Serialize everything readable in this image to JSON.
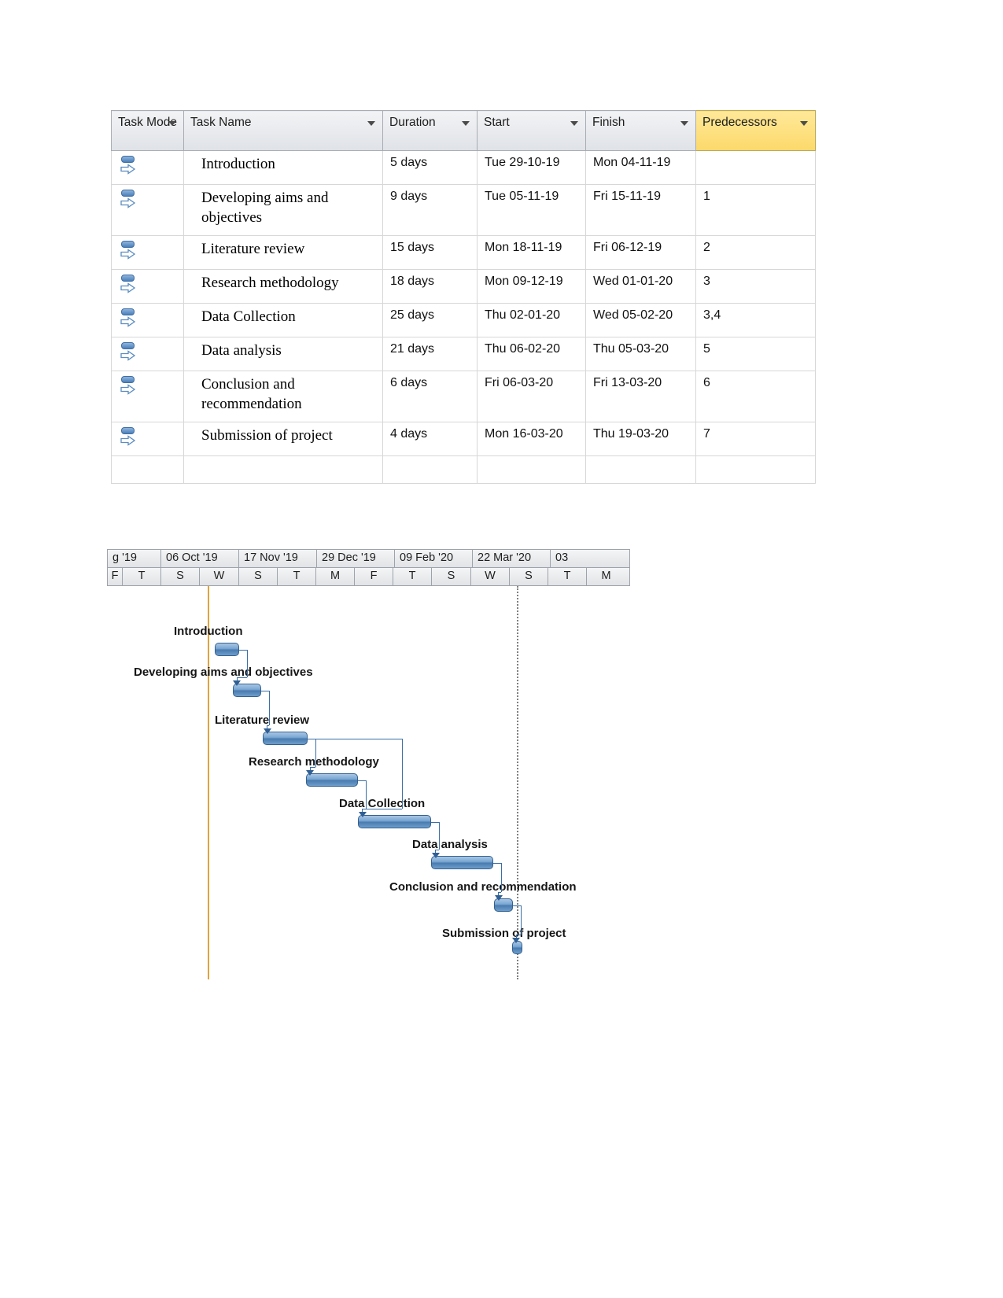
{
  "table": {
    "columns": [
      {
        "label": "Task Mode",
        "key": "mode"
      },
      {
        "label": "Task Name",
        "key": "name"
      },
      {
        "label": "Duration",
        "key": "duration"
      },
      {
        "label": "Start",
        "key": "start"
      },
      {
        "label": "Finish",
        "key": "finish"
      },
      {
        "label": "Predecessors",
        "key": "predecessors"
      }
    ],
    "header_accent_color": "#FCD96A",
    "rows": [
      {
        "mode_icon": "manually-scheduled-icon",
        "name": "Introduction",
        "duration": "5 days",
        "start": "Tue 29-10-19",
        "finish": "Mon 04-11-19",
        "predecessors": ""
      },
      {
        "mode_icon": "manually-scheduled-icon",
        "name": "Developing aims and objectives",
        "duration": "9 days",
        "start": "Tue 05-11-19",
        "finish": "Fri 15-11-19",
        "predecessors": "1"
      },
      {
        "mode_icon": "manually-scheduled-icon",
        "name": "Literature review",
        "duration": "15 days",
        "start": "Mon 18-11-19",
        "finish": "Fri 06-12-19",
        "predecessors": "2"
      },
      {
        "mode_icon": "manually-scheduled-icon",
        "name": "Research methodology",
        "duration": "18 days",
        "start": "Mon 09-12-19",
        "finish": "Wed 01-01-20",
        "predecessors": "3"
      },
      {
        "mode_icon": "manually-scheduled-icon",
        "name": "Data Collection",
        "duration": "25 days",
        "start": "Thu 02-01-20",
        "finish": "Wed 05-02-20",
        "predecessors": "3,4"
      },
      {
        "mode_icon": "manually-scheduled-icon",
        "name": "Data analysis",
        "duration": "21 days",
        "start": "Thu 06-02-20",
        "finish": "Thu 05-03-20",
        "predecessors": "5"
      },
      {
        "mode_icon": "manually-scheduled-icon",
        "name": "Conclusion and recommendation",
        "duration": "6 days",
        "start": "Fri 06-03-20",
        "finish": "Fri 13-03-20",
        "predecessors": "6"
      },
      {
        "mode_icon": "manually-scheduled-icon",
        "name": "Submission of project",
        "duration": "4 days",
        "start": "Mon 16-03-20",
        "finish": "Thu 19-03-20",
        "predecessors": "7"
      }
    ]
  },
  "chart_data": {
    "type": "gantt",
    "title": "",
    "timeline_major": [
      "g '19",
      "06 Oct '19",
      "17 Nov '19",
      "29 Dec '19",
      "09 Feb '20",
      "22 Mar '20",
      "03"
    ],
    "timeline_minor": [
      "F",
      "T",
      "S",
      "W",
      "S",
      "T",
      "M",
      "F",
      "T",
      "S",
      "W",
      "S",
      "T",
      "M"
    ],
    "bar_color": "#5B8DC0",
    "today_line_color": "#E0A33E",
    "status_line_color": "#7F7F7F",
    "tasks": [
      {
        "name": "Introduction",
        "duration_days": 5,
        "start": "Tue 29-10-19",
        "finish": "Mon 04-11-19",
        "bar_left_pct": 20.6,
        "bar_width_pct": 4.6,
        "row": 0
      },
      {
        "name": "Developing aims and objectives",
        "duration_days": 9,
        "start": "Tue 05-11-19",
        "finish": "Fri 15-11-19",
        "bar_left_pct": 24.0,
        "bar_width_pct": 5.5,
        "row": 1
      },
      {
        "name": "Literature review",
        "duration_days": 15,
        "start": "Mon 18-11-19",
        "finish": "Fri 06-12-19",
        "bar_left_pct": 29.8,
        "bar_width_pct": 8.5,
        "row": 2
      },
      {
        "name": "Research methodology",
        "duration_days": 18,
        "start": "Mon 09-12-19",
        "finish": "Wed 01-01-20",
        "bar_left_pct": 38.0,
        "bar_width_pct": 10.0,
        "row": 3
      },
      {
        "name": "Data Collection",
        "duration_days": 25,
        "start": "Thu 02-01-20",
        "finish": "Wed 05-02-20",
        "bar_left_pct": 48.0,
        "bar_width_pct": 14.0,
        "row": 4
      },
      {
        "name": "Data analysis",
        "duration_days": 21,
        "start": "Thu 06-02-20",
        "finish": "Thu 05-03-20",
        "bar_left_pct": 62.0,
        "bar_width_pct": 11.8,
        "row": 5
      },
      {
        "name": "Conclusion and recommendation",
        "duration_days": 6,
        "start": "Fri 06-03-20",
        "finish": "Fri 13-03-20",
        "bar_left_pct": 74.0,
        "bar_width_pct": 3.6,
        "row": 6
      },
      {
        "name": "Submission of project",
        "duration_days": 4,
        "start": "Mon 16-03-20",
        "finish": "Thu 19-03-20",
        "bar_left_pct": 77.4,
        "bar_width_pct": 2.0,
        "row": 7
      }
    ]
  }
}
